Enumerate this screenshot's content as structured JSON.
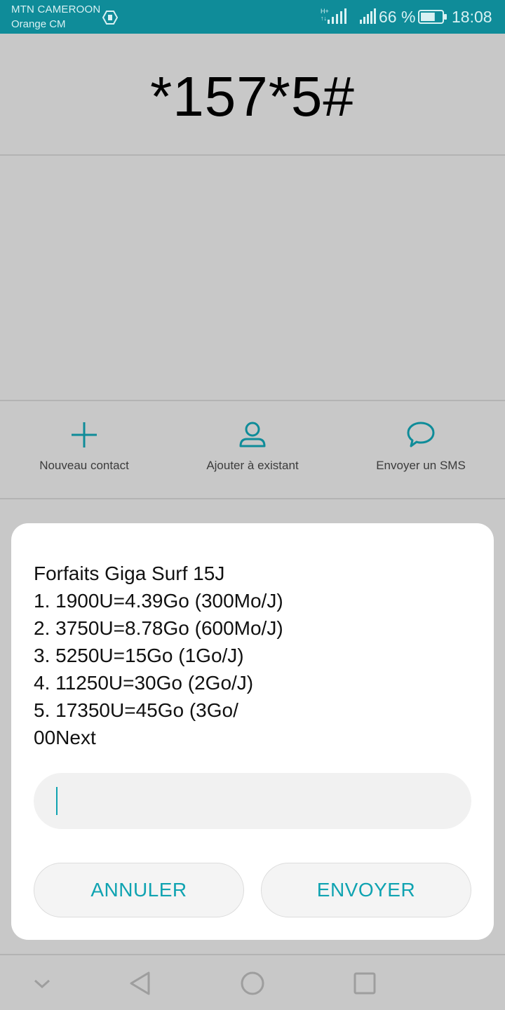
{
  "status_bar": {
    "carrier_primary": "MTN CAMEROON",
    "carrier_secondary": "Orange CM",
    "network_type_top": "H+",
    "network_type_bottom": "↑↓",
    "battery_percent": "66 %",
    "battery_level": 0.66,
    "time": "18:08",
    "background_color": "#0f8c99"
  },
  "dialer": {
    "number": "*157*5#"
  },
  "actions": [
    {
      "label": "Nouveau contact",
      "icon": "plus-icon"
    },
    {
      "label": "Ajouter à existant",
      "icon": "person-icon"
    },
    {
      "label": "Envoyer un SMS",
      "icon": "chat-bubble-icon"
    }
  ],
  "dialog": {
    "lines": [
      "Forfaits Giga Surf 15J",
      "1. 1900U=4.39Go (300Mo/J)",
      "2. 3750U=8.78Go (600Mo/J)",
      "3. 5250U=15Go (1Go/J)",
      "4. 11250U=30Go (2Go/J)",
      "5. 17350U=45Go (3Go/",
      "00Next"
    ],
    "input_value": "",
    "cancel_label": "ANNULER",
    "send_label": "ENVOYER",
    "accent_color": "#0fa3b1"
  },
  "nav_bar": {
    "icons": [
      "chevron-down-icon",
      "back-triangle-icon",
      "home-circle-icon",
      "recents-square-icon"
    ]
  }
}
